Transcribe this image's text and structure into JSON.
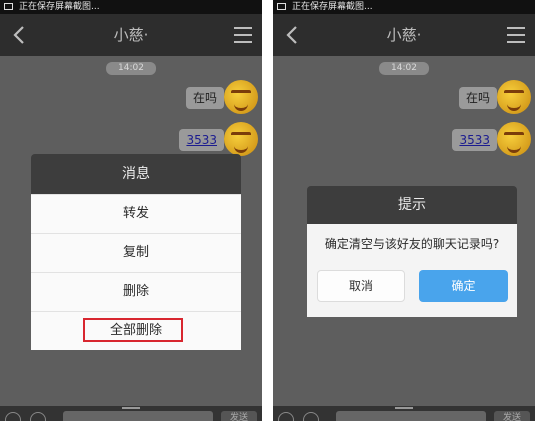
{
  "left": {
    "status_text": "正在保存屏幕截图...",
    "title": "小慈·",
    "time": "14:02",
    "messages": [
      {
        "text": "在吗"
      },
      {
        "text": "3533"
      }
    ],
    "dialog": {
      "title": "消息",
      "items": [
        "转发",
        "复制",
        "删除",
        "全部删除"
      ]
    },
    "send_label": "发送"
  },
  "right": {
    "status_text": "正在保存屏幕截图...",
    "title": "小慈·",
    "time": "14:02",
    "messages": [
      {
        "text": "在吗"
      },
      {
        "text": "3533"
      }
    ],
    "dialog": {
      "title": "提示",
      "message": "确定清空与该好友的聊天记录吗?",
      "cancel": "取消",
      "confirm": "确定"
    },
    "send_label": "发送"
  },
  "colors": {
    "highlight": "#d8262f",
    "confirm_button": "#49a4ec"
  },
  "icons": [
    "back-arrow-icon",
    "menu-icon",
    "screenshot-icon",
    "avatar-emoji"
  ]
}
